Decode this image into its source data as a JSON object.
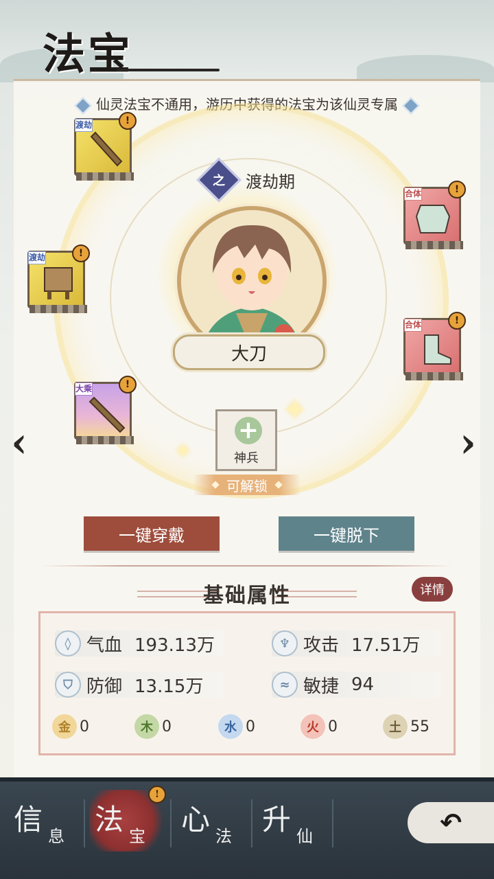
{
  "header": {
    "title": "法宝"
  },
  "notice": "仙灵法宝不通用，游历中获得的法宝为该仙灵专属",
  "realm": {
    "label": "渡劫期",
    "icon": "realm-emblem-icon",
    "glyph": "之"
  },
  "character": {
    "name": "大刀"
  },
  "equipment": [
    {
      "slot": "weapon-sword",
      "tag": "渡劫",
      "rarity": "gold",
      "alert": "!"
    },
    {
      "slot": "cauldron",
      "tag": "渡劫",
      "rarity": "gold",
      "alert": "!"
    },
    {
      "slot": "spear",
      "tag": "大乘",
      "rarity": "purple",
      "alert": "!"
    },
    {
      "slot": "armor",
      "tag": "合体",
      "rarity": "red",
      "alert": "!"
    },
    {
      "slot": "boots",
      "tag": "合体",
      "rarity": "red",
      "alert": "!"
    }
  ],
  "shenbing": {
    "label": "神兵",
    "unlock": "可解锁"
  },
  "buttons": {
    "wear_all": "一键穿戴",
    "remove_all": "一键脱下"
  },
  "attributes": {
    "title": "基础属性",
    "detail": "详情",
    "stats": [
      {
        "name": "气血",
        "value": "193.13万",
        "icon": "blood-drop-icon"
      },
      {
        "name": "攻击",
        "value": "17.51万",
        "icon": "attack-icon"
      },
      {
        "name": "防御",
        "value": "13.15万",
        "icon": "shield-icon"
      },
      {
        "name": "敏捷",
        "value": "94",
        "icon": "wing-icon"
      }
    ],
    "elements": [
      {
        "glyph": "金",
        "value": "0",
        "color": "#e0bb6a"
      },
      {
        "glyph": "木",
        "value": "0",
        "color": "#8fae6c"
      },
      {
        "glyph": "水",
        "value": "0",
        "color": "#7aa6d6"
      },
      {
        "glyph": "火",
        "value": "0",
        "color": "#d97a6a"
      },
      {
        "glyph": "土",
        "value": "55",
        "color": "#a89a78"
      }
    ]
  },
  "nav": {
    "tabs": [
      {
        "big": "信",
        "small": "息"
      },
      {
        "big": "法",
        "small": "宝",
        "alert": "!"
      },
      {
        "big": "心",
        "small": "法"
      },
      {
        "big": "升",
        "small": "仙"
      }
    ],
    "back_icon": "back-arrow-icon"
  },
  "colors": {
    "accent_red": "#9e4d3c",
    "accent_teal": "#5f838b",
    "gold": "#e7a33a"
  }
}
